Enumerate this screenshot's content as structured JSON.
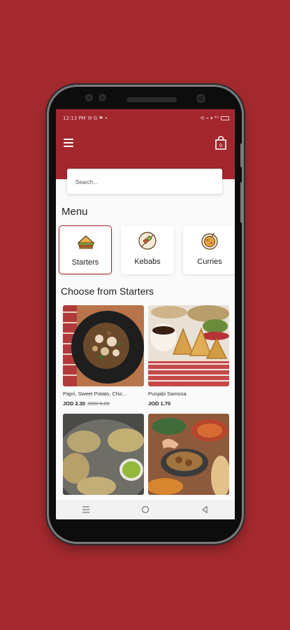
{
  "status_bar": {
    "time": "12:13 PM",
    "indicators": "✉ G ⚑ •",
    "right_icons": "⟲ ⌁ ▾ ⁴ᴳ"
  },
  "app_bar": {
    "menu_icon": "hamburger-menu-icon",
    "cart_icon": "shopping-bag-icon",
    "cart_count": "0"
  },
  "search": {
    "placeholder": "Search...",
    "value": ""
  },
  "menu_heading": "Menu",
  "categories": [
    {
      "label": "Starters",
      "icon": "sandwich-icon",
      "selected": true
    },
    {
      "label": "Kebabs",
      "icon": "kebab-skewer-icon",
      "selected": false
    },
    {
      "label": "Curries",
      "icon": "curry-bowl-icon",
      "selected": false
    }
  ],
  "section_heading": "Choose from Starters",
  "products": [
    {
      "name": "Papri, Sweet Potato, Chic...",
      "price": "JOD 2.30",
      "old_price": "JOD 0.00"
    },
    {
      "name": "Punjabi Samosa",
      "price": "JOD 1.70",
      "old_price": ""
    },
    {
      "name": "",
      "price": "",
      "old_price": ""
    },
    {
      "name": "",
      "price": "",
      "old_price": ""
    }
  ],
  "nav_bar": {
    "recents": "recents-icon",
    "home": "home-icon",
    "back": "back-icon"
  },
  "colors": {
    "brand": "#a3272d",
    "background": "#a52a2f"
  }
}
